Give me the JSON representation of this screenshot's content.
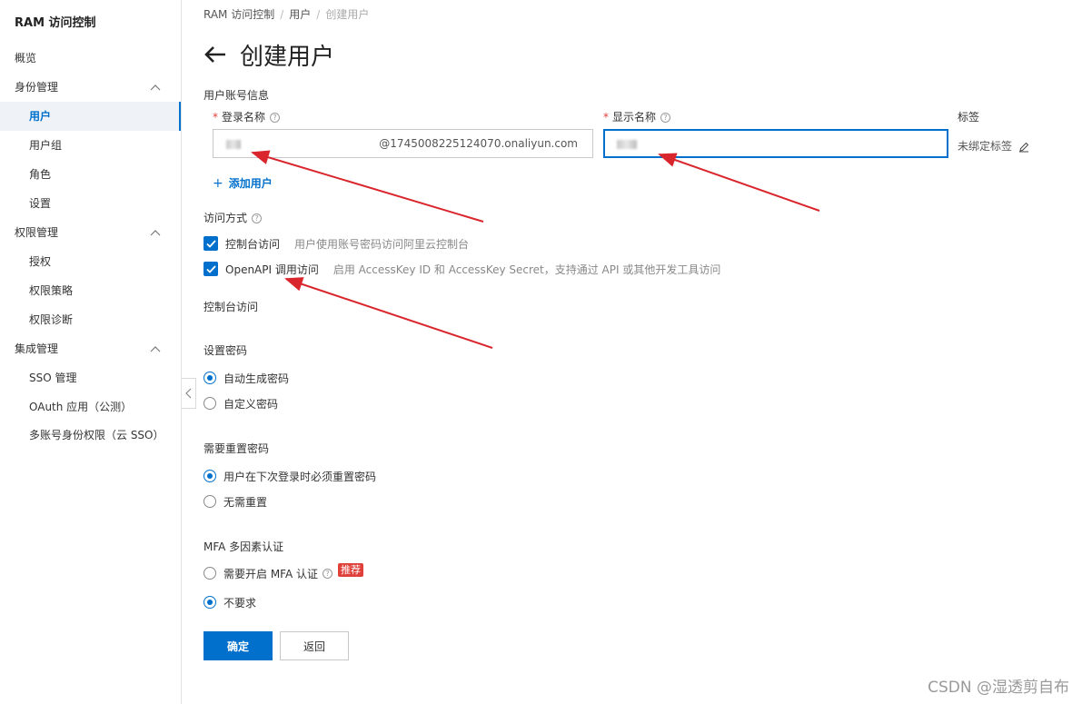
{
  "sidebar": {
    "title": "RAM 访问控制",
    "items": [
      {
        "label": "概览"
      },
      {
        "label": "身份管理"
      },
      {
        "label": "用户"
      },
      {
        "label": "用户组"
      },
      {
        "label": "角色"
      },
      {
        "label": "设置"
      },
      {
        "label": "权限管理"
      },
      {
        "label": "授权"
      },
      {
        "label": "权限策略"
      },
      {
        "label": "权限诊断"
      },
      {
        "label": "集成管理"
      },
      {
        "label": "SSO 管理"
      },
      {
        "label": "OAuth 应用（公测）"
      },
      {
        "label": "多账号身份权限（云 SSO）"
      }
    ]
  },
  "breadcrumb": {
    "root": "RAM 访问控制",
    "mid": "用户",
    "current": "创建用户"
  },
  "page": {
    "title": "创建用户"
  },
  "account_info": {
    "section": "用户账号信息",
    "login_label": "登录名称",
    "login_suffix": "@1745008225124070.onaliyun.com",
    "display_label": "显示名称",
    "tag_label": "标签",
    "tag_value": "未绑定标签",
    "add_user": "添加用户"
  },
  "access": {
    "section": "访问方式",
    "console_label": "控制台访问",
    "console_desc": "用户使用账号密码访问阿里云控制台",
    "api_label": "OpenAPI 调用访问",
    "api_desc": "启用 AccessKey ID 和 AccessKey Secret，支持通过 API 或其他开发工具访问"
  },
  "console": {
    "section": "控制台访问",
    "password_section": "设置密码",
    "pw_auto": "自动生成密码",
    "pw_custom": "自定义密码",
    "reset_section": "需要重置密码",
    "reset_yes": "用户在下次登录时必须重置密码",
    "reset_no": "无需重置",
    "mfa_section": "MFA 多因素认证",
    "mfa_yes": "需要开启 MFA 认证",
    "mfa_badge": "推荐",
    "mfa_no": "不要求"
  },
  "buttons": {
    "confirm": "确定",
    "back": "返回"
  },
  "watermark": "CSDN @湿透剪自布",
  "colors": {
    "primary": "#0070cc",
    "required": "#e0403a",
    "annotation_arrow": "#d9262d"
  }
}
